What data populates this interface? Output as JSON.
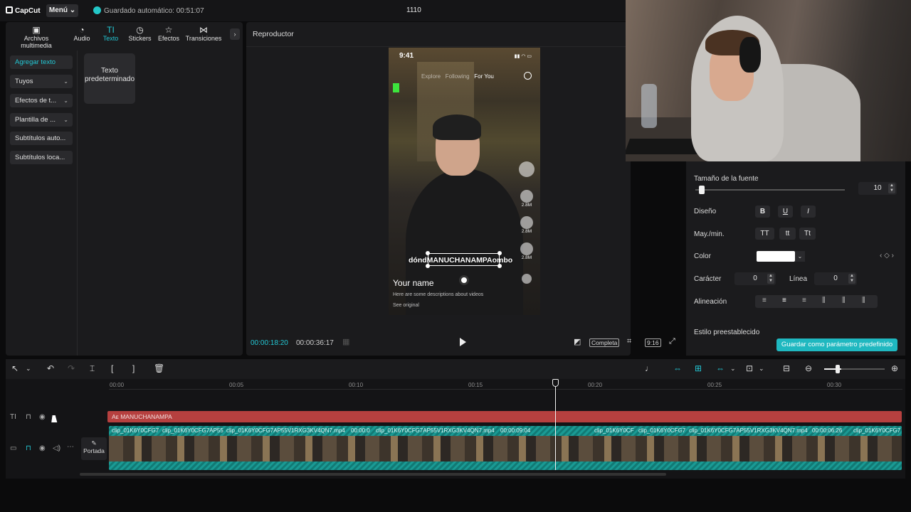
{
  "topbar": {
    "app_name": "CapCut",
    "menu_label": "Menú",
    "autosave": "Guardado automático: 00:51:07",
    "project_title": "1110"
  },
  "tabs": [
    {
      "label": "Archivos multimedia",
      "icon": "media-icon"
    },
    {
      "label": "Audio",
      "icon": "audio-icon"
    },
    {
      "label": "Texto",
      "icon": "text-icon",
      "active": true
    },
    {
      "label": "Stickers",
      "icon": "sticker-icon"
    },
    {
      "label": "Efectos",
      "icon": "effects-icon"
    },
    {
      "label": "Transiciones",
      "icon": "transitions-icon"
    }
  ],
  "sidebar": {
    "items": [
      {
        "label": "Agregar texto"
      },
      {
        "label": "Tuyos"
      },
      {
        "label": "Efectos de t..."
      },
      {
        "label": "Plantilla de ..."
      },
      {
        "label": "Subtítulos auto..."
      },
      {
        "label": "Subtítulos loca..."
      }
    ]
  },
  "text_card": {
    "label": "Texto predeterminado"
  },
  "player": {
    "title": "Reproductor",
    "current_time": "00:00:18:20",
    "total_time": "00:00:36:17",
    "ratio_label": "Completa",
    "aspect_label": "9:16"
  },
  "video": {
    "clock": "9:41",
    "tab_explore": "Explore",
    "tab_following": "Following",
    "tab_foryou": "For You",
    "likes": "2.8M",
    "comments": "2.8M",
    "saves": "2.8M",
    "caption": "dóndMANUCHANAMPAombo",
    "name": "Your name",
    "description": "Here are some descriptions about videos",
    "see_original": "See original"
  },
  "props": {
    "font_size_label": "Tamaño de la fuente",
    "font_size_value": "10",
    "font_size_level": 0.03,
    "design_label": "Diseño",
    "bold": "B",
    "underline": "U",
    "italic": "I",
    "case_label": "May./min.",
    "case_upper": "TT",
    "case_lower": "tt",
    "case_title": "Tt",
    "color_label": "Color",
    "color_value": "#ffffff",
    "char_label": "Carácter",
    "char_value": "0",
    "line_label": "Línea",
    "line_value": "0",
    "align_label": "Alineación",
    "preset_label": "Estilo preestablecido",
    "save_preset": "Guardar como parámetro predefinido"
  },
  "timeline": {
    "ruler": [
      "00:00",
      "00:05",
      "00:10",
      "00:15",
      "00:20",
      "00:25",
      "00:30"
    ],
    "text_clip": "MANUCHANAMPA",
    "clip_labels": [
      "clip_01K6Y0CFG7",
      "clip_01K6Y0CFG7AP55",
      "clip_01K6Y0CFG7AP55V1RXG3KV4QN7.mp4",
      "00:00:0",
      "clip_01K6Y0CFG7AP55V1RXG3KV4QN7.mp4",
      "00:00:09:04",
      "clip_01K6Y0CF",
      "clip_01K6Y0CFG7",
      "clip_01K6Y0CFG7AP55V1RXG3KV4QN7.mp4",
      "00:00:06:26",
      "clip_01K6Y0CFG7"
    ],
    "cover_label": "Portada"
  },
  "colors": {
    "accent": "#23c7d4",
    "text_clip": "#b6403f",
    "video_clip": "#1a9a94"
  }
}
